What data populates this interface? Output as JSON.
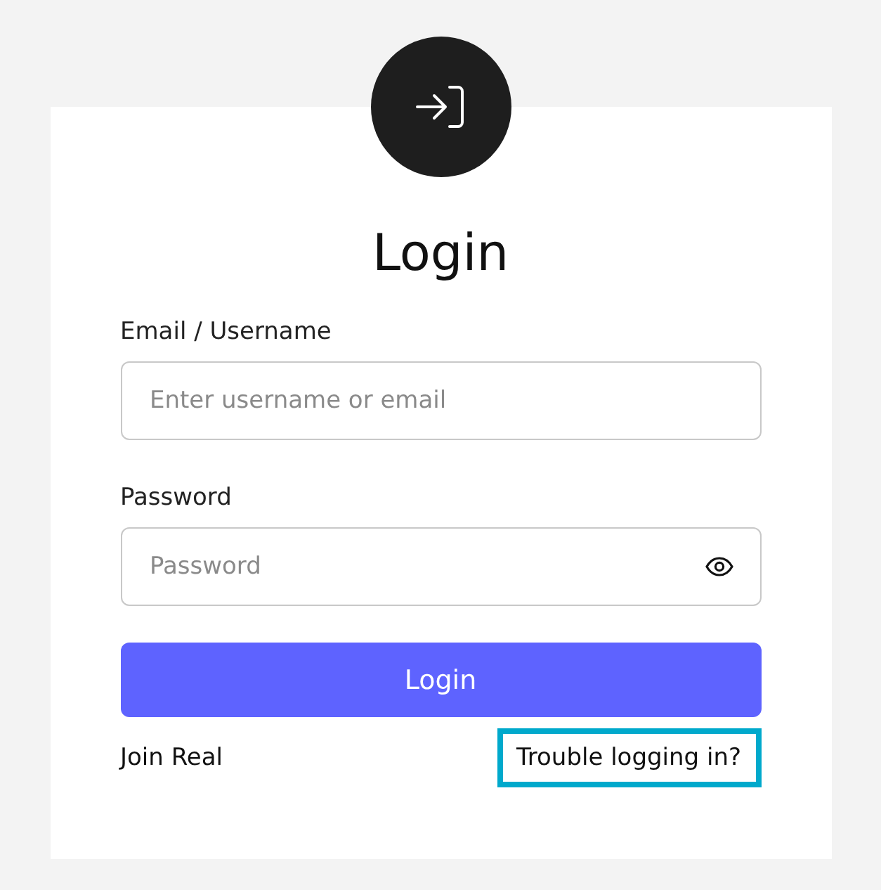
{
  "title": "Login",
  "fields": [
    {
      "label": "Email / Username",
      "placeholder": "Enter username or email",
      "kind": "text"
    },
    {
      "label": "Password",
      "placeholder": "Password",
      "kind": "password"
    }
  ],
  "submit": "Login",
  "links": [
    {
      "text": "Join Real",
      "focused": false
    },
    {
      "text": "Trouble logging in?",
      "focused": true
    }
  ]
}
